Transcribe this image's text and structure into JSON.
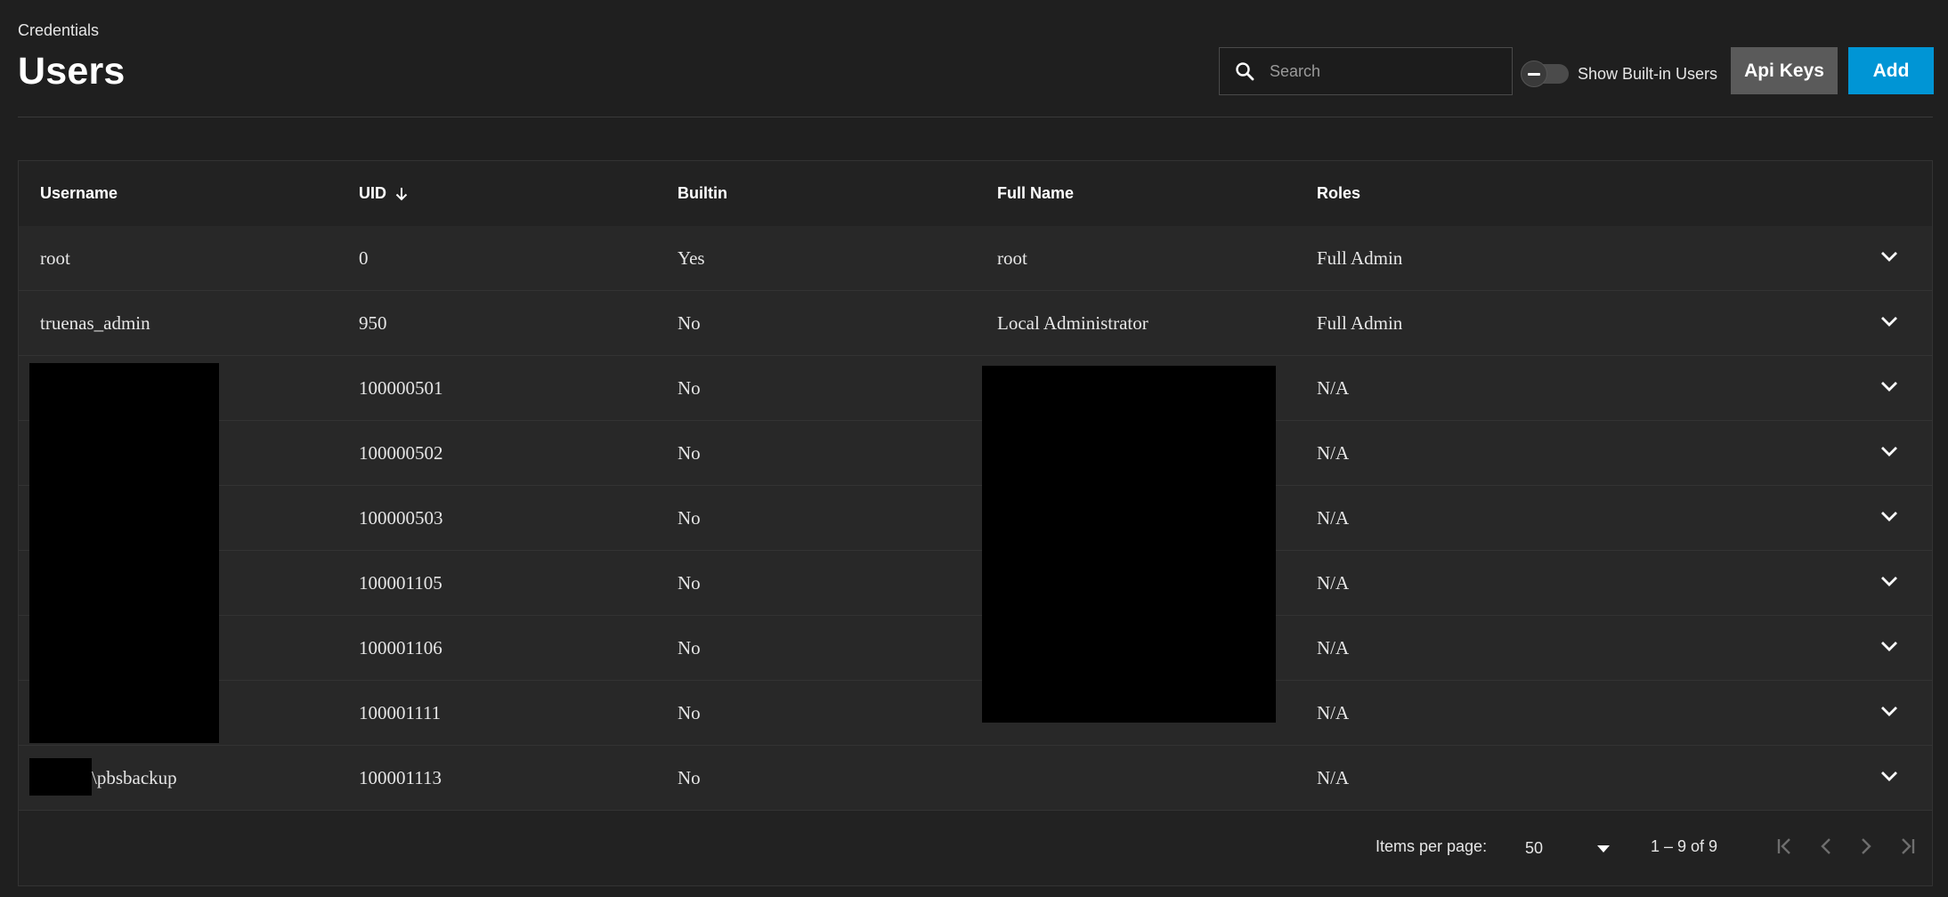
{
  "header": {
    "breadcrumb": "Credentials",
    "title": "Users"
  },
  "toolbar": {
    "search_placeholder": "Search",
    "search_value": "",
    "show_builtin_label": "Show Built-in Users",
    "show_builtin_on": false,
    "api_keys_label": "Api Keys",
    "add_label": "Add"
  },
  "table": {
    "columns": [
      "Username",
      "UID",
      "Builtin",
      "Full Name",
      "Roles"
    ],
    "sort_column": "UID",
    "sort_direction": "arrow-down-icon",
    "rows": [
      {
        "username": "root",
        "uid": "0",
        "builtin": "Yes",
        "full_name": "root",
        "roles": "Full Admin"
      },
      {
        "username": "truenas_admin",
        "uid": "950",
        "builtin": "No",
        "full_name": "Local Administrator",
        "roles": "Full Admin"
      },
      {
        "username": "",
        "uid": "100000501",
        "builtin": "No",
        "full_name": "",
        "roles": "N/A"
      },
      {
        "username": "",
        "uid": "100000502",
        "builtin": "No",
        "full_name": "",
        "roles": "N/A"
      },
      {
        "username": "",
        "uid": "100000503",
        "builtin": "No",
        "full_name": "",
        "roles": "N/A"
      },
      {
        "username": "",
        "uid": "100001105",
        "builtin": "No",
        "full_name": "",
        "roles": "N/A"
      },
      {
        "username": "",
        "uid": "100001106",
        "builtin": "No",
        "full_name": "",
        "roles": "N/A"
      },
      {
        "username": "",
        "uid": "100001111",
        "builtin": "No",
        "full_name": "",
        "roles": "N/A"
      },
      {
        "username": "\\pbsbackup",
        "uid": "100001113",
        "builtin": "No",
        "full_name": "",
        "roles": "N/A"
      }
    ]
  },
  "paginator": {
    "items_per_page_label": "Items per page:",
    "items_per_page_value": "50",
    "range_label": "1 – 9 of 9"
  },
  "colors": {
    "background": "#1f1f1f",
    "primary": "#0095d5",
    "secondary_button": "#5a5a5a",
    "redaction": "#000000"
  }
}
